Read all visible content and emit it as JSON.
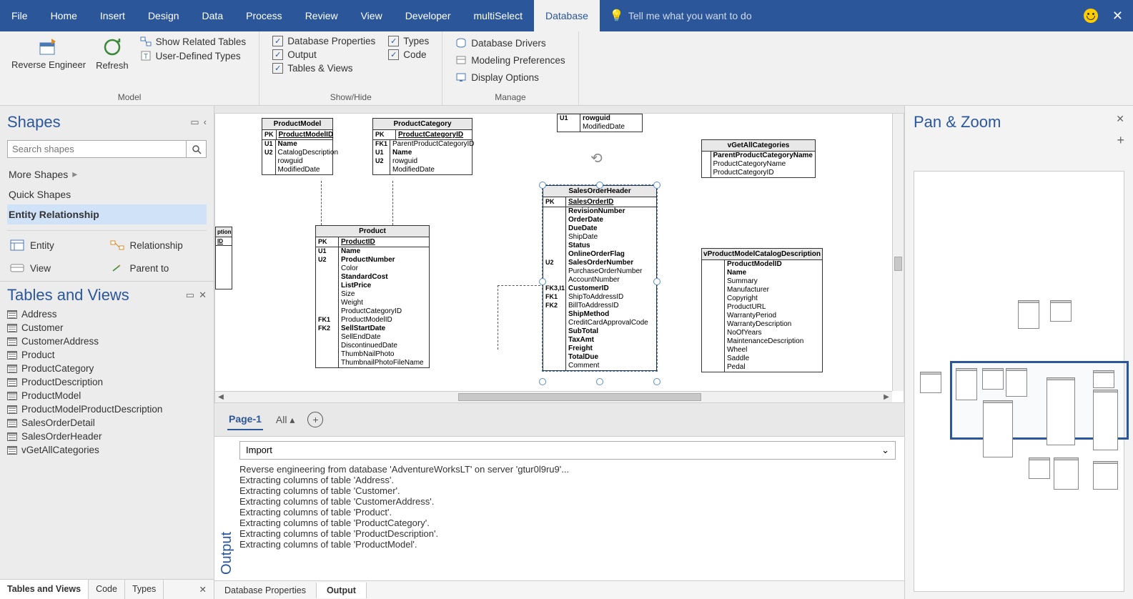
{
  "ribbon": {
    "tabs": [
      "File",
      "Home",
      "Insert",
      "Design",
      "Data",
      "Process",
      "Review",
      "View",
      "Developer",
      "multiSelect",
      "Database"
    ],
    "active": "Database",
    "tellme": "Tell me what you want to do",
    "groups": {
      "model": {
        "label": "Model",
        "reverse": "Reverse Engineer",
        "refresh": "Refresh",
        "related": "Show Related Tables",
        "userdef": "User-Defined Types"
      },
      "showhide": {
        "label": "Show/Hide",
        "dbprops": "Database Properties",
        "output": "Output",
        "tableviews": "Tables & Views",
        "types": "Types",
        "code": "Code"
      },
      "manage": {
        "label": "Manage",
        "drivers": "Database Drivers",
        "modeling": "Modeling Preferences",
        "display": "Display Options"
      }
    }
  },
  "shapes": {
    "title": "Shapes",
    "search_placeholder": "Search shapes",
    "more": "More Shapes",
    "quick": "Quick Shapes",
    "stencil": "Entity Relationship",
    "items": {
      "entity": "Entity",
      "relationship": "Relationship",
      "view": "View",
      "parent": "Parent to"
    }
  },
  "tv": {
    "title": "Tables and Views",
    "items": [
      "Address",
      "Customer",
      "CustomerAddress",
      "Product",
      "ProductCategory",
      "ProductDescription",
      "ProductModel",
      "ProductModelProductDescription",
      "SalesOrderDetail",
      "SalesOrderHeader",
      "vGetAllCategories"
    ],
    "tabs": [
      "Tables and Views",
      "Code",
      "Types"
    ]
  },
  "pagebar": {
    "page": "Page-1",
    "all": "All"
  },
  "output": {
    "dropdown": "Import",
    "lines": [
      "Reverse engineering from database 'AdventureWorksLT' on server 'gtur0l9ru9'...",
      "Extracting columns of table 'Address'.",
      "Extracting columns of table 'Customer'.",
      "Extracting columns of table 'CustomerAddress'.",
      "Extracting columns of table 'Product'.",
      "Extracting columns of table 'ProductCategory'.",
      "Extracting columns of table 'ProductDescription'.",
      "Extracting columns of table 'ProductModel'."
    ]
  },
  "bottom_tabs": [
    "Database Properties",
    "Output"
  ],
  "panzoom": {
    "title": "Pan & Zoom"
  },
  "entities": {
    "productmodel": {
      "name": "ProductModel",
      "pk": "ProductModelID",
      "keys": [
        "U1",
        "U2",
        ""
      ],
      "cols": [
        "Name",
        "CatalogDescription",
        "rowguid",
        "ModifiedDate"
      ]
    },
    "productcategory": {
      "name": "ProductCategory",
      "pk": "ProductCategoryID",
      "keys": [
        "FK1",
        "U1",
        "U2",
        ""
      ],
      "cols": [
        "ParentProductCategoryID",
        "Name",
        "rowguid",
        "ModifiedDate"
      ]
    },
    "prodfrag": {
      "keys": [
        "U1",
        ""
      ],
      "cols": [
        "rowguid",
        "ModifiedDate"
      ]
    },
    "product": {
      "name": "Product",
      "pk": "ProductID",
      "keys": [
        "U1",
        "U2",
        "",
        "",
        "",
        "",
        "",
        "",
        "FK1",
        "FK2",
        "",
        "",
        "",
        ""
      ],
      "cols": [
        "Name",
        "ProductNumber",
        "Color",
        "StandardCost",
        "ListPrice",
        "Size",
        "Weight",
        "ProductCategoryID",
        "ProductModelID",
        "SellStartDate",
        "SellEndDate",
        "DiscontinuedDate",
        "ThumbNailPhoto",
        "ThumbnailPhotoFileName"
      ]
    },
    "salesorderheader": {
      "name": "SalesOrderHeader",
      "pk": "SalesOrderID",
      "keys": [
        "",
        "",
        "",
        "",
        "",
        "",
        "U2",
        "",
        "",
        "FK3,I1",
        "FK1",
        "FK2",
        "",
        "",
        "",
        "",
        "",
        ""
      ],
      "cols": [
        "RevisionNumber",
        "OrderDate",
        "DueDate",
        "ShipDate",
        "Status",
        "OnlineOrderFlag",
        "SalesOrderNumber",
        "PurchaseOrderNumber",
        "AccountNumber",
        "CustomerID",
        "ShipToAddressID",
        "BillToAddressID",
        "ShipMethod",
        "CreditCardApprovalCode",
        "SubTotal",
        "TaxAmt",
        "Freight",
        "TotalDue",
        "Comment"
      ]
    },
    "vgetall": {
      "name": "vGetAllCategories",
      "cols": [
        "ParentProductCategoryName",
        "ProductCategoryName",
        "ProductCategoryID"
      ]
    },
    "vproductmodel": {
      "name": "vProductModelCatalogDescription",
      "cols": [
        "ProductModelID",
        "Name",
        "Summary",
        "Manufacturer",
        "Copyright",
        "ProductURL",
        "WarrantyPeriod",
        "WarrantyDescription",
        "NoOfYears",
        "MaintenanceDescription",
        "Wheel",
        "Saddle",
        "Pedal"
      ]
    },
    "partial1": {
      "cols": [
        "ption",
        "ID"
      ]
    }
  }
}
